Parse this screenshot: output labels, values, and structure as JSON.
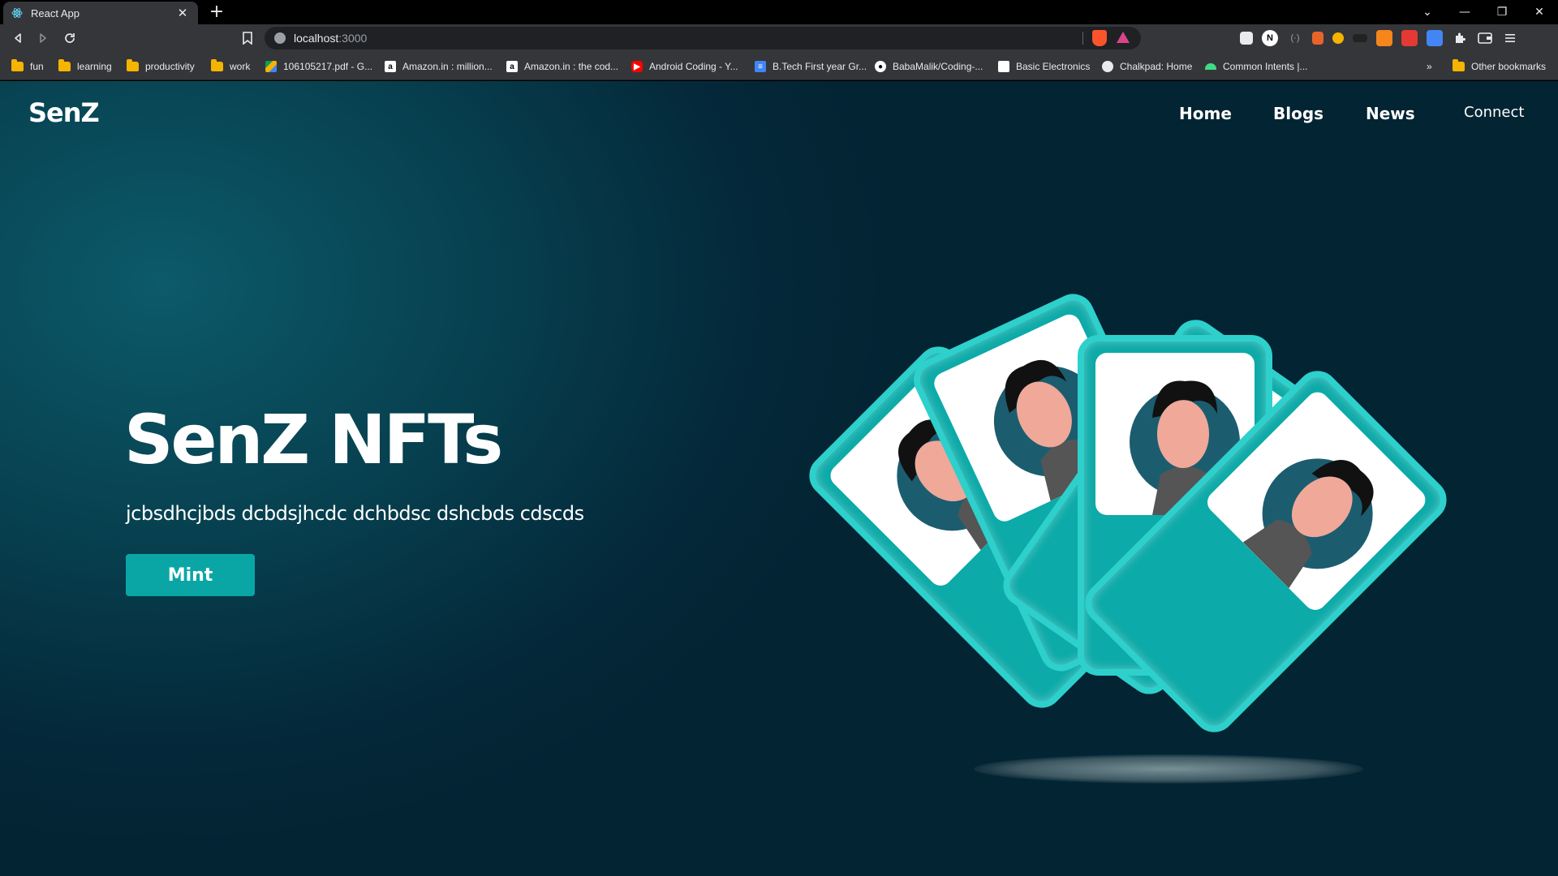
{
  "browser": {
    "tab_title": "React App",
    "tab_close": "✕",
    "new_tab": "+",
    "url_host": "localhost",
    "url_port": ":3000",
    "window_controls": [
      "⌄",
      "—",
      "❐",
      "✕"
    ],
    "bookmarks": [
      {
        "label": "fun",
        "icon": "folder-icon"
      },
      {
        "label": "learning",
        "icon": "folder-icon"
      },
      {
        "label": "productivity",
        "icon": "folder-icon"
      },
      {
        "label": "work",
        "icon": "folder-icon"
      },
      {
        "label": "106105217.pdf - G...",
        "icon": "google-drive-icon"
      },
      {
        "label": "Amazon.in : million...",
        "icon": "amazon-icon"
      },
      {
        "label": "Amazon.in : the cod...",
        "icon": "amazon-icon"
      },
      {
        "label": "Android Coding - Y...",
        "icon": "youtube-icon"
      },
      {
        "label": "B.Tech First year Gr...",
        "icon": "google-docs-icon"
      },
      {
        "label": "BabaMalik/Coding-...",
        "icon": "github-icon"
      },
      {
        "label": "Basic Electronics",
        "icon": "page-icon"
      },
      {
        "label": "Chalkpad: Home",
        "icon": "chalkpad-icon"
      },
      {
        "label": "Common Intents |...",
        "icon": "android-icon"
      }
    ],
    "bookmarks_overflow": "»",
    "other_bookmarks": "Other bookmarks"
  },
  "app": {
    "brand": "SenZ",
    "nav": [
      "Home",
      "Blogs",
      "News"
    ],
    "connect_label": "Connect",
    "hero_title": "SenZ NFTs",
    "hero_subtitle": "jcbsdhcjbds dcbdsjhcdc dchbdsc dshcbds cdscds",
    "mint_label": "Mint"
  },
  "colors": {
    "accent": "#0aa6a6",
    "card_border": "#2ed0cc",
    "background": "#04293a"
  }
}
